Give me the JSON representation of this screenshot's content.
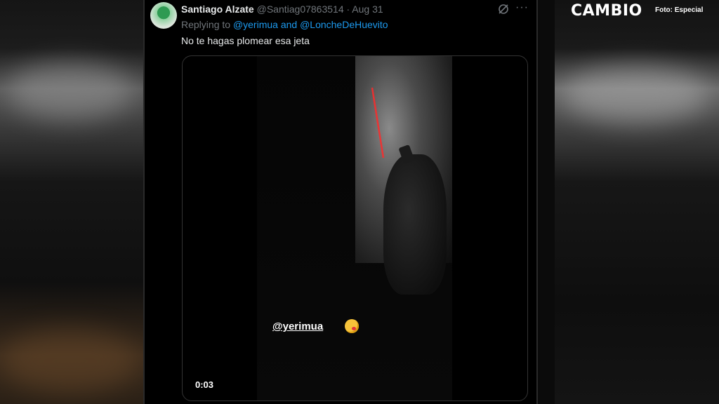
{
  "tweet": {
    "author_name": "Santiago Alzate",
    "author_handle": "@Santiag07863514",
    "separator": "·",
    "date": "Aug 31",
    "replying_prefix": "Replying to",
    "replying_to": "@yerimua and @LoncheDeHuevito",
    "text": "No te hagas plomear esa jeta",
    "more_icon": "more-icon",
    "grok_icon": "grok-icon"
  },
  "video": {
    "duration": "0:03",
    "caption_mention": "@yerimua"
  },
  "branding": {
    "logo": "CAMBIO",
    "credit": "Foto: Especial"
  },
  "colors": {
    "link": "#1d9bf0",
    "muted": "#71767b",
    "text": "#e7e9ea",
    "laser": "#ff2a2a"
  }
}
